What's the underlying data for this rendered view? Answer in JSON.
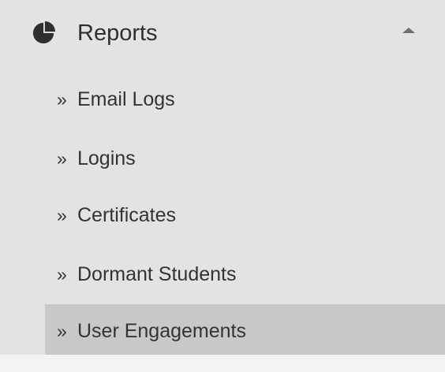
{
  "sidebar": {
    "section": {
      "title": "Reports",
      "icon": "pie-chart-icon",
      "toggle_icon": "caret-up-icon"
    },
    "items": [
      {
        "prefix": "»",
        "label": "Email Logs"
      },
      {
        "prefix": "»",
        "label": "Logins"
      },
      {
        "prefix": "»",
        "label": "Certificates"
      },
      {
        "prefix": "»",
        "label": "Dormant Students"
      },
      {
        "prefix": "»",
        "label": "User Engagements"
      }
    ],
    "active_item": "User Engagements"
  },
  "colors": {
    "sidebar_background": "#e3e3e3",
    "active_item_background": "#c8c8c8",
    "text": "#333333",
    "icon": "#2f2f2f"
  }
}
